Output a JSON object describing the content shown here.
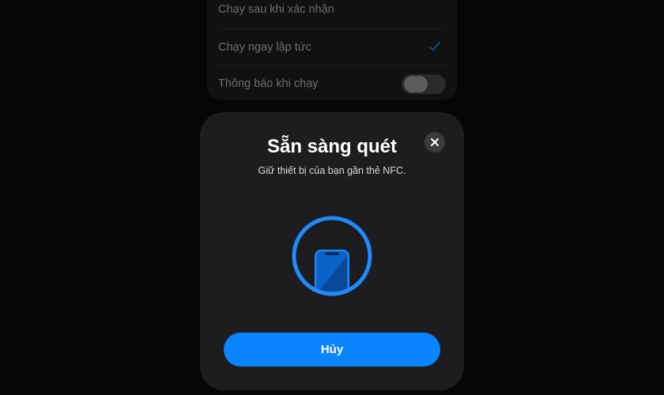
{
  "settings": {
    "rows": [
      {
        "label": "Chạy sau khi xác nhận",
        "checked": false
      },
      {
        "label": "Chạy ngay lập tức",
        "checked": true
      },
      {
        "label": "Thông báo khi chạy",
        "toggle_on": false
      }
    ]
  },
  "nfc_sheet": {
    "title": "Sẵn sàng quét",
    "subtitle": "Giữ thiết bị của bạn gần thẻ NFC.",
    "close_icon": "close-icon",
    "graphic_icon": "phone-icon",
    "cancel_label": "Hủy"
  },
  "colors": {
    "accent": "#0a84ff",
    "sheet_background": "#1d1d1f",
    "page_background": "#060606"
  }
}
